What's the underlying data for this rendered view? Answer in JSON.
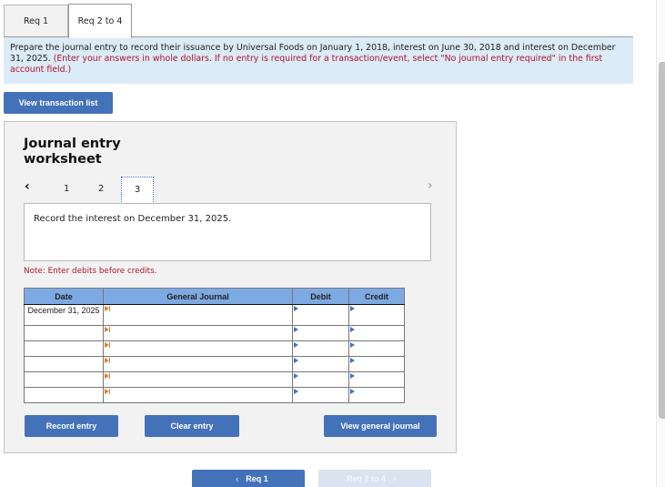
{
  "tabs": [
    {
      "label": "Req 1",
      "active": false
    },
    {
      "label": "Req 2 to 4",
      "active": true
    }
  ],
  "instructions": {
    "text": "Prepare the journal entry to record their issuance by Universal Foods on January 1, 2018, interest on June 30, 2018 and interest on December 31, 2025.",
    "note_red": "(Enter your answers in whole dollars. If no entry is required for a transaction/event, select \"No journal entry required\" in the first account field.)"
  },
  "buttons": {
    "view_transaction_list": "View transaction list",
    "record_entry": "Record entry",
    "clear_entry": "Clear entry",
    "view_general_journal": "View general journal"
  },
  "worksheet": {
    "title_line1": "Journal entry",
    "title_line2": "worksheet",
    "nav": {
      "prev_icon": "‹",
      "pages": [
        "1",
        "2",
        "3"
      ],
      "current_page": "3",
      "next_icon": "›"
    },
    "description": "Record the interest on December 31, 2025.",
    "note": "Note: Enter debits before credits."
  },
  "journal_table": {
    "headers": {
      "date": "Date",
      "general_journal": "General Journal",
      "debit": "Debit",
      "credit": "Credit"
    },
    "rows": [
      {
        "date": "December 31, 2025",
        "account": "",
        "debit": "",
        "credit": ""
      },
      {
        "date": "",
        "account": "",
        "debit": "",
        "credit": ""
      },
      {
        "date": "",
        "account": "",
        "debit": "",
        "credit": ""
      },
      {
        "date": "",
        "account": "",
        "debit": "",
        "credit": ""
      },
      {
        "date": "",
        "account": "",
        "debit": "",
        "credit": ""
      },
      {
        "date": "",
        "account": "",
        "debit": "",
        "credit": ""
      }
    ]
  },
  "bottom_nav": {
    "prev_label": "Req 1",
    "prev_icon": "‹",
    "next_label": "Req 2 to 4",
    "next_icon": "›"
  },
  "colors": {
    "button_blue": "#4472b9",
    "header_blue": "#7eaae4",
    "instruction_bg": "#dbebf7",
    "red_text": "#b3142d",
    "panel_bg": "#f2f2f2"
  }
}
